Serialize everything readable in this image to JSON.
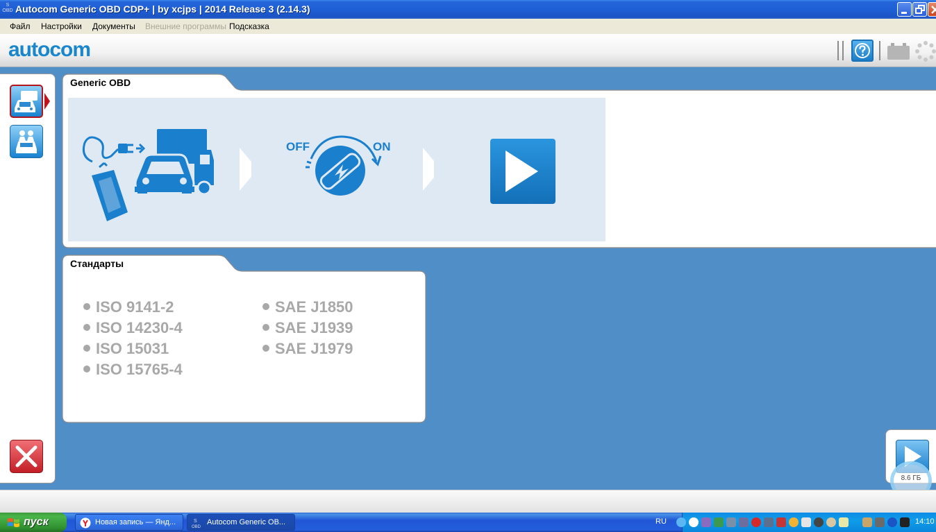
{
  "window": {
    "title": "Autocom Generic OBD CDP+  |  by xcjps  |  2014 Release 3 (2.14.3)",
    "icon_text": "OBD"
  },
  "menu": {
    "items": [
      {
        "label": "Файл",
        "enabled": true
      },
      {
        "label": "Настройки",
        "enabled": true
      },
      {
        "label": "Документы",
        "enabled": true
      },
      {
        "label": "Внешние программы",
        "enabled": false
      },
      {
        "label": "Подсказка",
        "enabled": true
      }
    ]
  },
  "header": {
    "logo": "autocom",
    "help_icon": "question-icon",
    "battery_icon": "battery-icon",
    "activity_icon": "spinner-icon"
  },
  "generic_obd": {
    "tab_label": "Generic OBD",
    "steps": [
      {
        "icon": "connect-vehicle-icon"
      },
      {
        "icon": "ignition-icon",
        "off_label": "OFF",
        "on_label": "ON"
      },
      {
        "icon": "play-icon"
      }
    ]
  },
  "standards": {
    "tab_label": "Стандарты",
    "left_column": [
      "ISO 9141-2",
      "ISO 14230-4",
      "ISO 15031",
      "ISO 15765-4"
    ],
    "right_column": [
      "SAE J1850",
      "SAE J1939",
      "SAE J1979"
    ]
  },
  "overlay": {
    "memory_label": "8.6 ГБ"
  },
  "taskbar": {
    "start_label": "пуск",
    "tasks": [
      {
        "label": "Новая запись — Янд...",
        "icon": "yandex-icon",
        "active": false
      },
      {
        "label": "Autocom Generic OB...",
        "icon": "obd-app-icon",
        "active": true
      }
    ],
    "language": "RU",
    "clock": "14:10"
  },
  "colors": {
    "workspace": "#4f8ec7",
    "accent_blue": "#1a7fcc",
    "step_bg": "#dfe9f3",
    "standard_text": "#a8a8a8",
    "exit_red": "#c31f27"
  }
}
